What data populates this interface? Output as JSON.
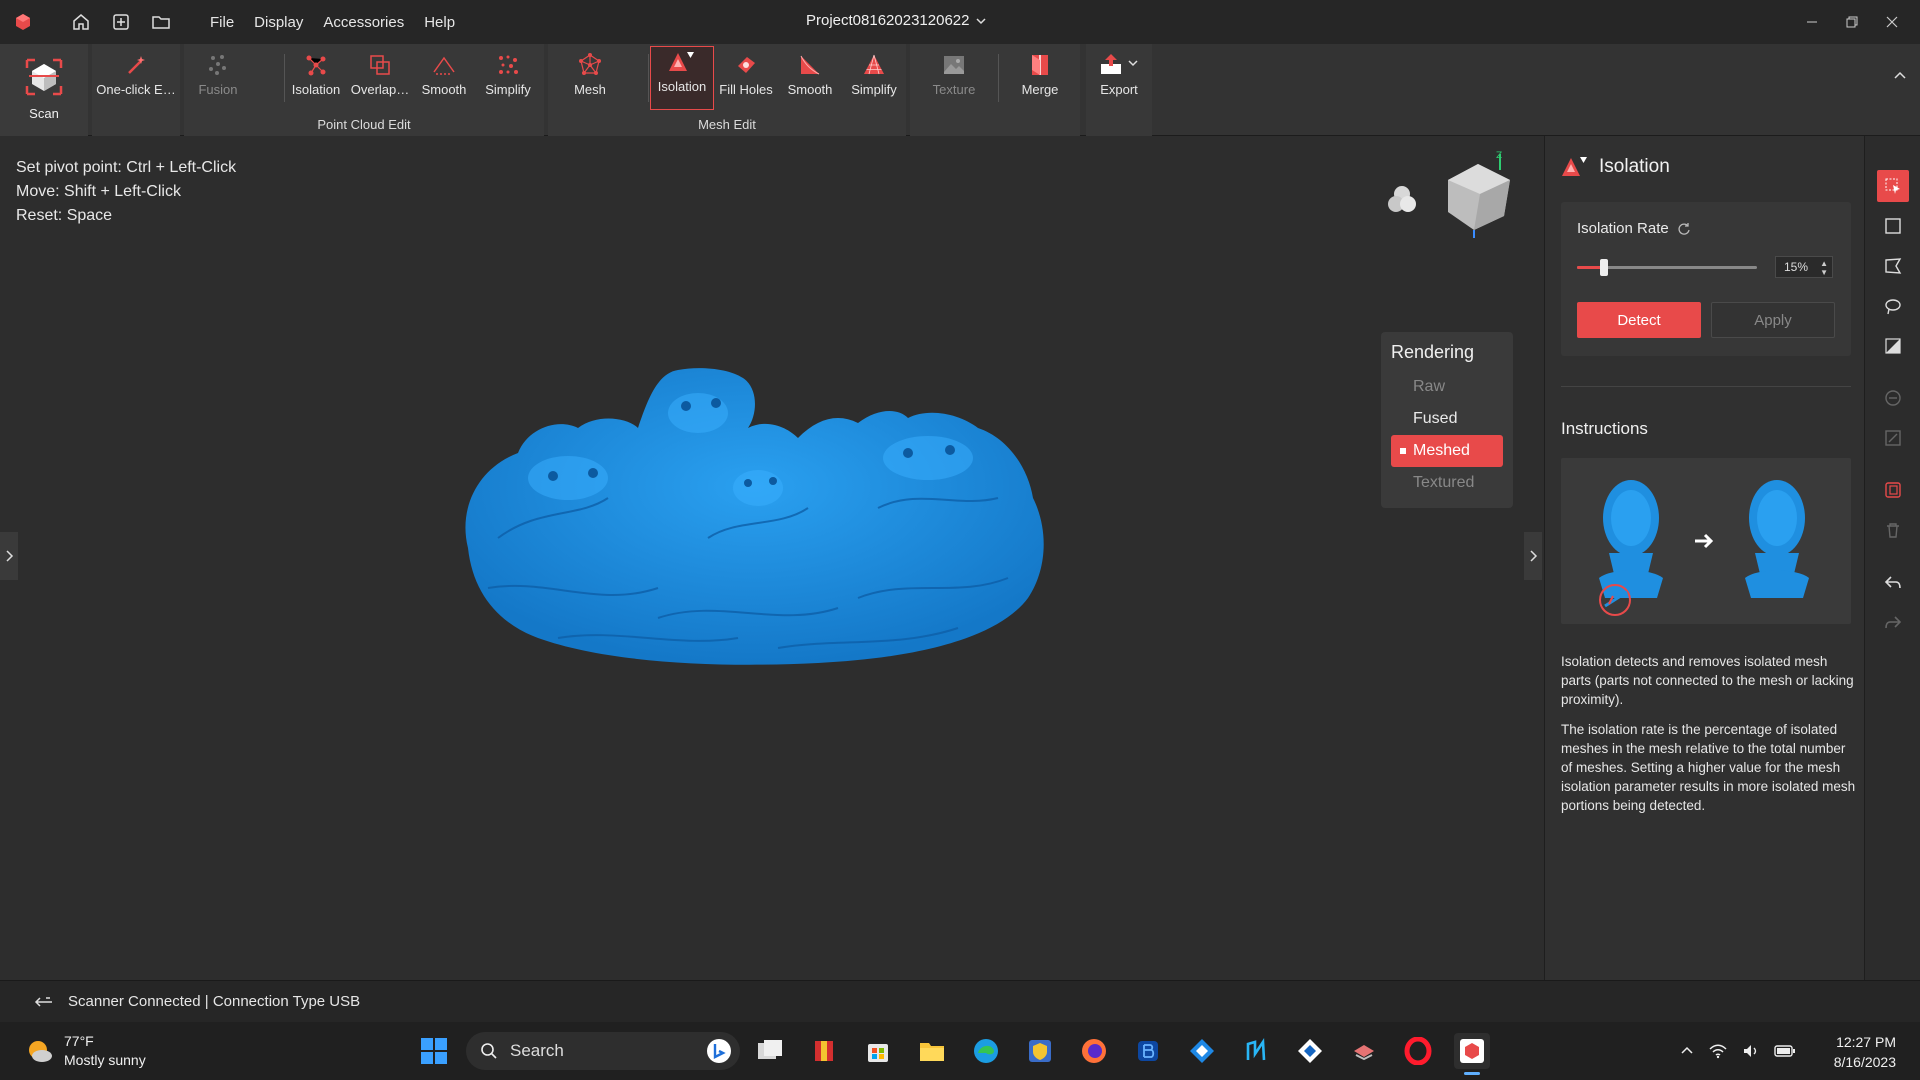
{
  "menu": [
    "File",
    "Display",
    "Accessories",
    "Help"
  ],
  "project_title": "Project08162023120622",
  "ribbon": {
    "scan_label": "Scan",
    "point_cloud_group": "Point Cloud Edit",
    "mesh_group": "Mesh Edit",
    "tools": {
      "one_click": "One-click E…",
      "fusion": "Fusion",
      "pc_isolation": "Isolation",
      "overlap": "Overlap…",
      "pc_smooth": "Smooth",
      "pc_simplify": "Simplify",
      "mesh": "Mesh",
      "isolation": "Isolation",
      "fill_holes": "Fill Holes",
      "smooth": "Smooth",
      "simplify": "Simplify",
      "texture": "Texture",
      "merge": "Merge",
      "export": "Export"
    }
  },
  "hints": {
    "pivot_label": "Set pivot point: ",
    "pivot_keys": "Ctrl + Left-Click",
    "move_label": "Move: ",
    "move_keys": "Shift + Left-Click",
    "reset_label": "Reset: ",
    "reset_keys": "Space"
  },
  "rendering": {
    "title": "Rendering",
    "options": [
      "Raw",
      "Fused",
      "Meshed",
      "Textured"
    ],
    "selected": "Meshed"
  },
  "panel": {
    "title": "Isolation",
    "rate_label": "Isolation Rate",
    "rate_value": "15%",
    "rate_fraction": 0.15,
    "detect_label": "Detect",
    "apply_label": "Apply",
    "instructions_title": "Instructions",
    "instruction_p1": "Isolation detects and removes isolated mesh parts (parts not connected to the mesh or lacking proximity).",
    "instruction_p2": "The isolation rate is the percentage of isolated meshes in the mesh relative to the total number of meshes. Setting a higher value for the mesh isolation parameter results in more isolated mesh portions being detected."
  },
  "status": {
    "text": "Scanner Connected | Connection Type USB"
  },
  "taskbar": {
    "temperature": "77°F",
    "weather": "Mostly sunny",
    "search_placeholder": "Search",
    "time": "12:27 PM",
    "date": "8/16/2023"
  },
  "colors": {
    "accent": "#e84a4a",
    "model": "#1f8fe0"
  }
}
